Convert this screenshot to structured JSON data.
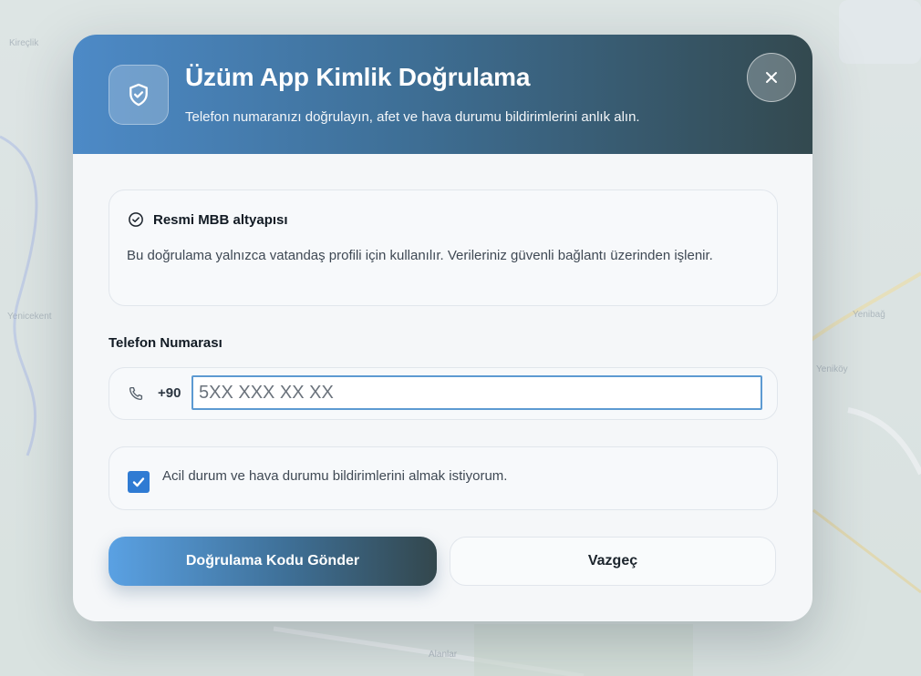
{
  "map": {
    "labels": [
      "Kireçlik",
      "Yenicekent",
      "Yenibağ",
      "Yeniköy",
      "Alanlar"
    ]
  },
  "modal": {
    "title": "Üzüm App Kimlik Doğrulama",
    "subtitle": "Telefon numaranızı doğrulayın, afet ve hava durumu bildirimlerini anlık alın.",
    "header_gradient": [
      "#4d8ac7",
      "#33494f"
    ],
    "shield_icon": "shield-check-icon",
    "close_icon": "close-icon"
  },
  "info_card": {
    "icon": "check-circle-icon",
    "title": "Resmi MBB altyapısı",
    "text": "Bu doğrulama yalnızca vatandaş profili için kullanılır. Verileriniz güvenli bağlantı üzerinden işlenir."
  },
  "phone": {
    "label": "Telefon Numarası",
    "icon": "phone-icon",
    "country_code": "+90",
    "placeholder": "5XX XXX XX XX",
    "value": ""
  },
  "consent": {
    "checked": true,
    "text": "Acil durum ve hava durumu bildirimlerini almak istiyorum.",
    "accent": "#2f7bd3"
  },
  "actions": {
    "primary_label": "Doğrulama Kodu Gönder",
    "secondary_label": "Vazgeç"
  }
}
